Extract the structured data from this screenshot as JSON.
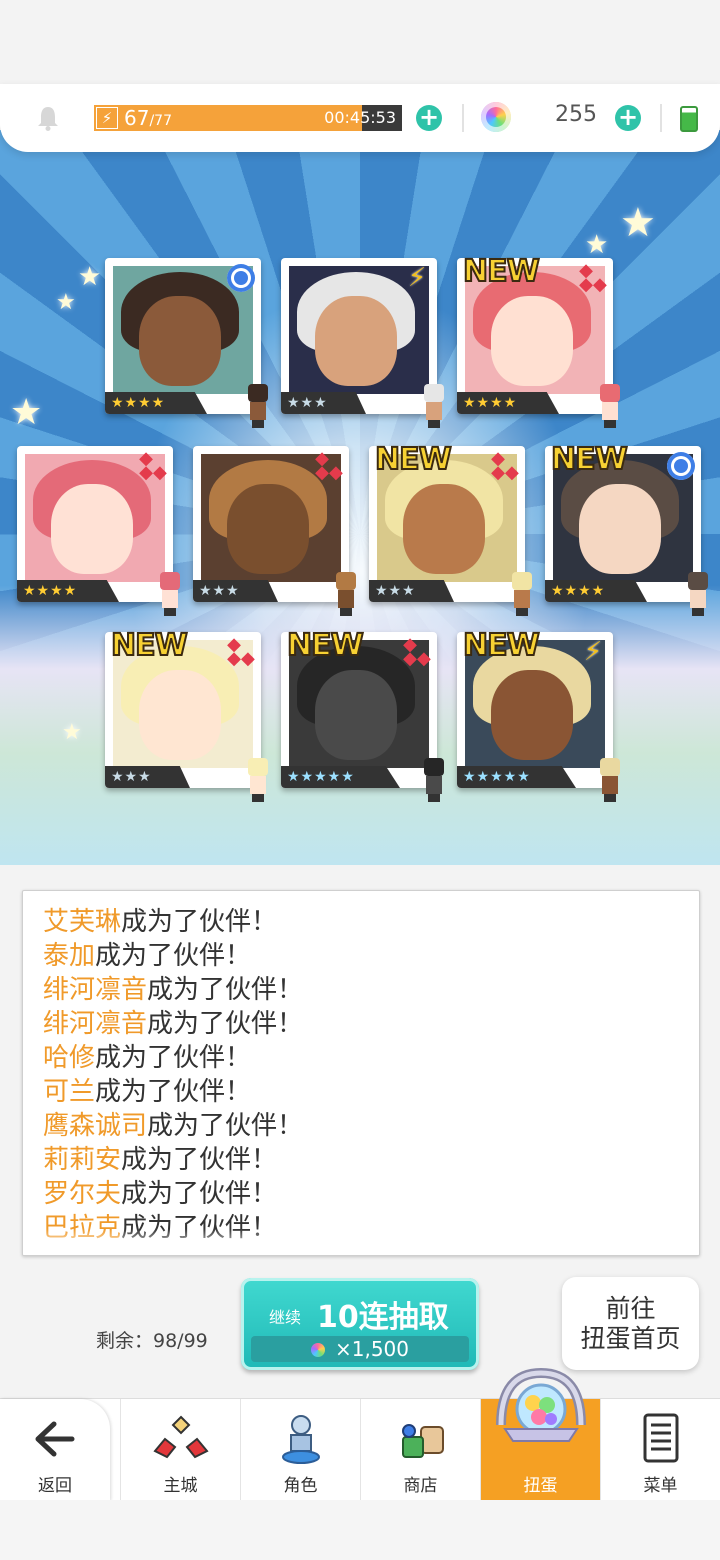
{
  "status_bar": {
    "stamina_value": "67",
    "stamina_max": "/77",
    "stamina_fill_pct": 87,
    "stamina_timer": "00:45:53",
    "gem_count": "255"
  },
  "cards": [
    {
      "new": "",
      "type": "circle",
      "stars": "★★★★",
      "rarity": "gold",
      "skin": "#8b5a3a",
      "hair": "#3b2a22",
      "bg": "#6fa6a0"
    },
    {
      "new": "",
      "type": "bolt",
      "stars": "★★★",
      "rarity": "silver",
      "skin": "#d8a27c",
      "hair": "#e6e6e6",
      "bg": "#2a2e4a"
    },
    {
      "new": "NEW",
      "type": "diamond",
      "stars": "★★★★",
      "rarity": "gold",
      "skin": "#ffe0d2",
      "hair": "#e86b72",
      "bg": "#f2b3b6"
    },
    {
      "new": "",
      "type": "diamond",
      "stars": "★★★★",
      "rarity": "gold",
      "skin": "#ffe1d5",
      "hair": "#e46a78",
      "bg": "#f1a9b1"
    },
    {
      "new": "",
      "type": "diamond",
      "stars": "★★★",
      "rarity": "silver",
      "skin": "#7a4f2e",
      "hair": "#b27a44",
      "bg": "#5b4030"
    },
    {
      "new": "NEW",
      "type": "diamond",
      "stars": "★★★",
      "rarity": "silver",
      "skin": "#b97a4b",
      "hair": "#f1e4a4",
      "bg": "#d9c98b"
    },
    {
      "new": "NEW",
      "type": "circle",
      "stars": "★★★★",
      "rarity": "gold",
      "skin": "#f5d7c2",
      "hair": "#5a4c44",
      "bg": "#2f3440"
    },
    {
      "new": "NEW",
      "type": "diamond",
      "stars": "★★★",
      "rarity": "silver",
      "skin": "#ffe6d2",
      "hair": "#f8eeb4",
      "bg": "#f3ecd0"
    },
    {
      "new": "NEW",
      "type": "diamond",
      "stars": "★★★★★",
      "rarity": "rainbow",
      "skin": "#4a4a4a",
      "hair": "#262626",
      "bg": "#3a3a3a"
    },
    {
      "new": "NEW",
      "type": "bolt",
      "stars": "★★★★★",
      "rarity": "rainbow",
      "skin": "#8a5534",
      "hair": "#e9d8a0",
      "bg": "#3a4a5a"
    }
  ],
  "log": {
    "suffix": "成为了伙伴！",
    "names": [
      "艾芙琳",
      "泰加",
      "绯河凛音",
      "绯河凛音",
      "哈修",
      "可兰",
      "鹰森诚司",
      "莉莉安",
      "罗尔夫",
      "巴拉克"
    ]
  },
  "actions": {
    "remaining": "剩余：98/99",
    "continue_label": "继续",
    "pull_label": "10连抽取",
    "pull_cost": "×1,500",
    "home_line1": "前往",
    "home_line2": "扭蛋首页"
  },
  "nav": {
    "back": "返回",
    "items": [
      "主城",
      "角色",
      "商店",
      "扭蛋",
      "菜单"
    ],
    "active_index": 3
  },
  "colors": {
    "accent_orange": "#f5a023",
    "teal": "#2fc3a9",
    "log_name": "#f09a2a"
  }
}
